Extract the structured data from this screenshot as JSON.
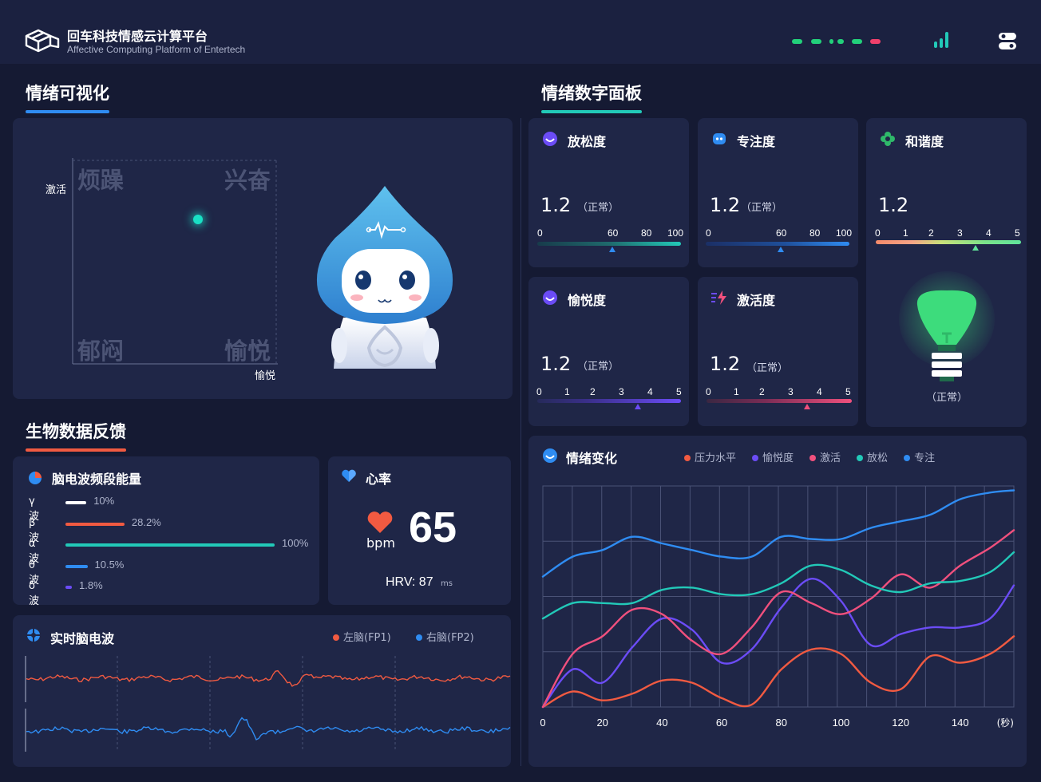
{
  "header": {
    "title": "回车科技情感云计算平台",
    "subtitle": "Affective Computing Platform of Entertech",
    "signal_colors": [
      "#22d07a",
      "#22d07a",
      "#22d07a",
      "#22d07a",
      "#f0406b"
    ]
  },
  "viz": {
    "title": "情绪可视化",
    "y_label": "激活",
    "x_label": "愉悦",
    "quadrants": {
      "tl": "烦躁",
      "tr": "兴奋",
      "bl": "郁闷",
      "br": "愉悦"
    },
    "point_color": "#19e0c4"
  },
  "panel": {
    "title": "情绪数字面板",
    "relax": {
      "label": "放松度",
      "value": "1.2",
      "status": "（正常）",
      "ticks": [
        "0",
        "60",
        "80",
        "100"
      ]
    },
    "focus": {
      "label": "专注度",
      "value": "1.2",
      "status": "（正常）",
      "ticks": [
        "0",
        "60",
        "80",
        "100"
      ]
    },
    "harmony": {
      "label": "和谐度",
      "value": "1.2",
      "status": "（正常）",
      "ticks": [
        "0",
        "1",
        "2",
        "3",
        "4",
        "5"
      ]
    },
    "pleasure": {
      "label": "愉悦度",
      "value": "1.2",
      "status": "（正常）",
      "ticks": [
        "0",
        "1",
        "2",
        "3",
        "4",
        "5"
      ]
    },
    "arousal": {
      "label": "激活度",
      "value": "1.2",
      "status": "（正常）",
      "ticks": [
        "0",
        "1",
        "2",
        "3",
        "4",
        "5"
      ]
    }
  },
  "bio": {
    "title": "生物数据反馈",
    "eeg_bands": {
      "title": "脑电波频段能量",
      "items": [
        {
          "label": "γ 波",
          "pct": "10%",
          "value": 10,
          "color": "#ffffff"
        },
        {
          "label": "β 波",
          "pct": "28.2%",
          "value": 28.2,
          "color": "#f15a41"
        },
        {
          "label": "α 波",
          "pct": "100%",
          "value": 100,
          "color": "#22c9b8"
        },
        {
          "label": "θ 波",
          "pct": "10.5%",
          "value": 10.5,
          "color": "#2f8cf2"
        },
        {
          "label": "δ 波",
          "pct": "1.8%",
          "value": 1.8,
          "color": "#6b4cf6"
        }
      ]
    },
    "heart": {
      "title": "心率",
      "value": "65",
      "unit": "bpm",
      "hrv_label": "HRV: 87",
      "hrv_unit": "ms"
    },
    "eeg_live": {
      "title": "实时脑电波",
      "left": "左脑(FP1)",
      "right": "右脑(FP2)",
      "left_color": "#f15a41",
      "right_color": "#2f8cf2"
    }
  },
  "trend": {
    "title": "情绪变化",
    "x_unit": "(秒)",
    "legend": [
      {
        "name": "压力水平",
        "color": "#f15a41"
      },
      {
        "name": "愉悦度",
        "color": "#6b4cf6"
      },
      {
        "name": "激活",
        "color": "#f0507d"
      },
      {
        "name": "放松",
        "color": "#22c9b8"
      },
      {
        "name": "专注",
        "color": "#2f8cf2"
      }
    ]
  },
  "chart_data": {
    "type": "line",
    "title": "情绪变化",
    "xlabel": "(秒)",
    "ylabel": "",
    "x": [
      0,
      10,
      20,
      30,
      40,
      50,
      60,
      70,
      80,
      90,
      100,
      110,
      120,
      130,
      140,
      150,
      158
    ],
    "xticks": [
      0,
      20,
      40,
      60,
      80,
      100,
      120,
      140
    ],
    "ylim": [
      0,
      100
    ],
    "grid": true,
    "legend_position": "top",
    "series": [
      {
        "name": "压力水平",
        "color": "#f15a41",
        "values": [
          0,
          7,
          3,
          6,
          12,
          11,
          4,
          1,
          17,
          26,
          24,
          11,
          8,
          23,
          20,
          24,
          32
        ]
      },
      {
        "name": "愉悦度",
        "color": "#6b4cf6",
        "values": [
          0,
          17,
          11,
          27,
          40,
          35,
          20,
          26,
          45,
          58,
          48,
          28,
          33,
          36,
          36,
          40,
          55
        ]
      },
      {
        "name": "激活",
        "color": "#f0507d",
        "values": [
          0,
          24,
          32,
          44,
          42,
          30,
          24,
          36,
          52,
          47,
          42,
          49,
          60,
          54,
          64,
          72,
          80
        ]
      },
      {
        "name": "放松",
        "color": "#22c9b8",
        "values": [
          40,
          47,
          47,
          47,
          53,
          54,
          51,
          51,
          56,
          64,
          62,
          55,
          52,
          56,
          57,
          61,
          70
        ]
      },
      {
        "name": "专注",
        "color": "#2f8cf2",
        "values": [
          59,
          68,
          71,
          77,
          74,
          71,
          68,
          68,
          77,
          76,
          76,
          81,
          84,
          87,
          94,
          97,
          98
        ]
      }
    ]
  }
}
